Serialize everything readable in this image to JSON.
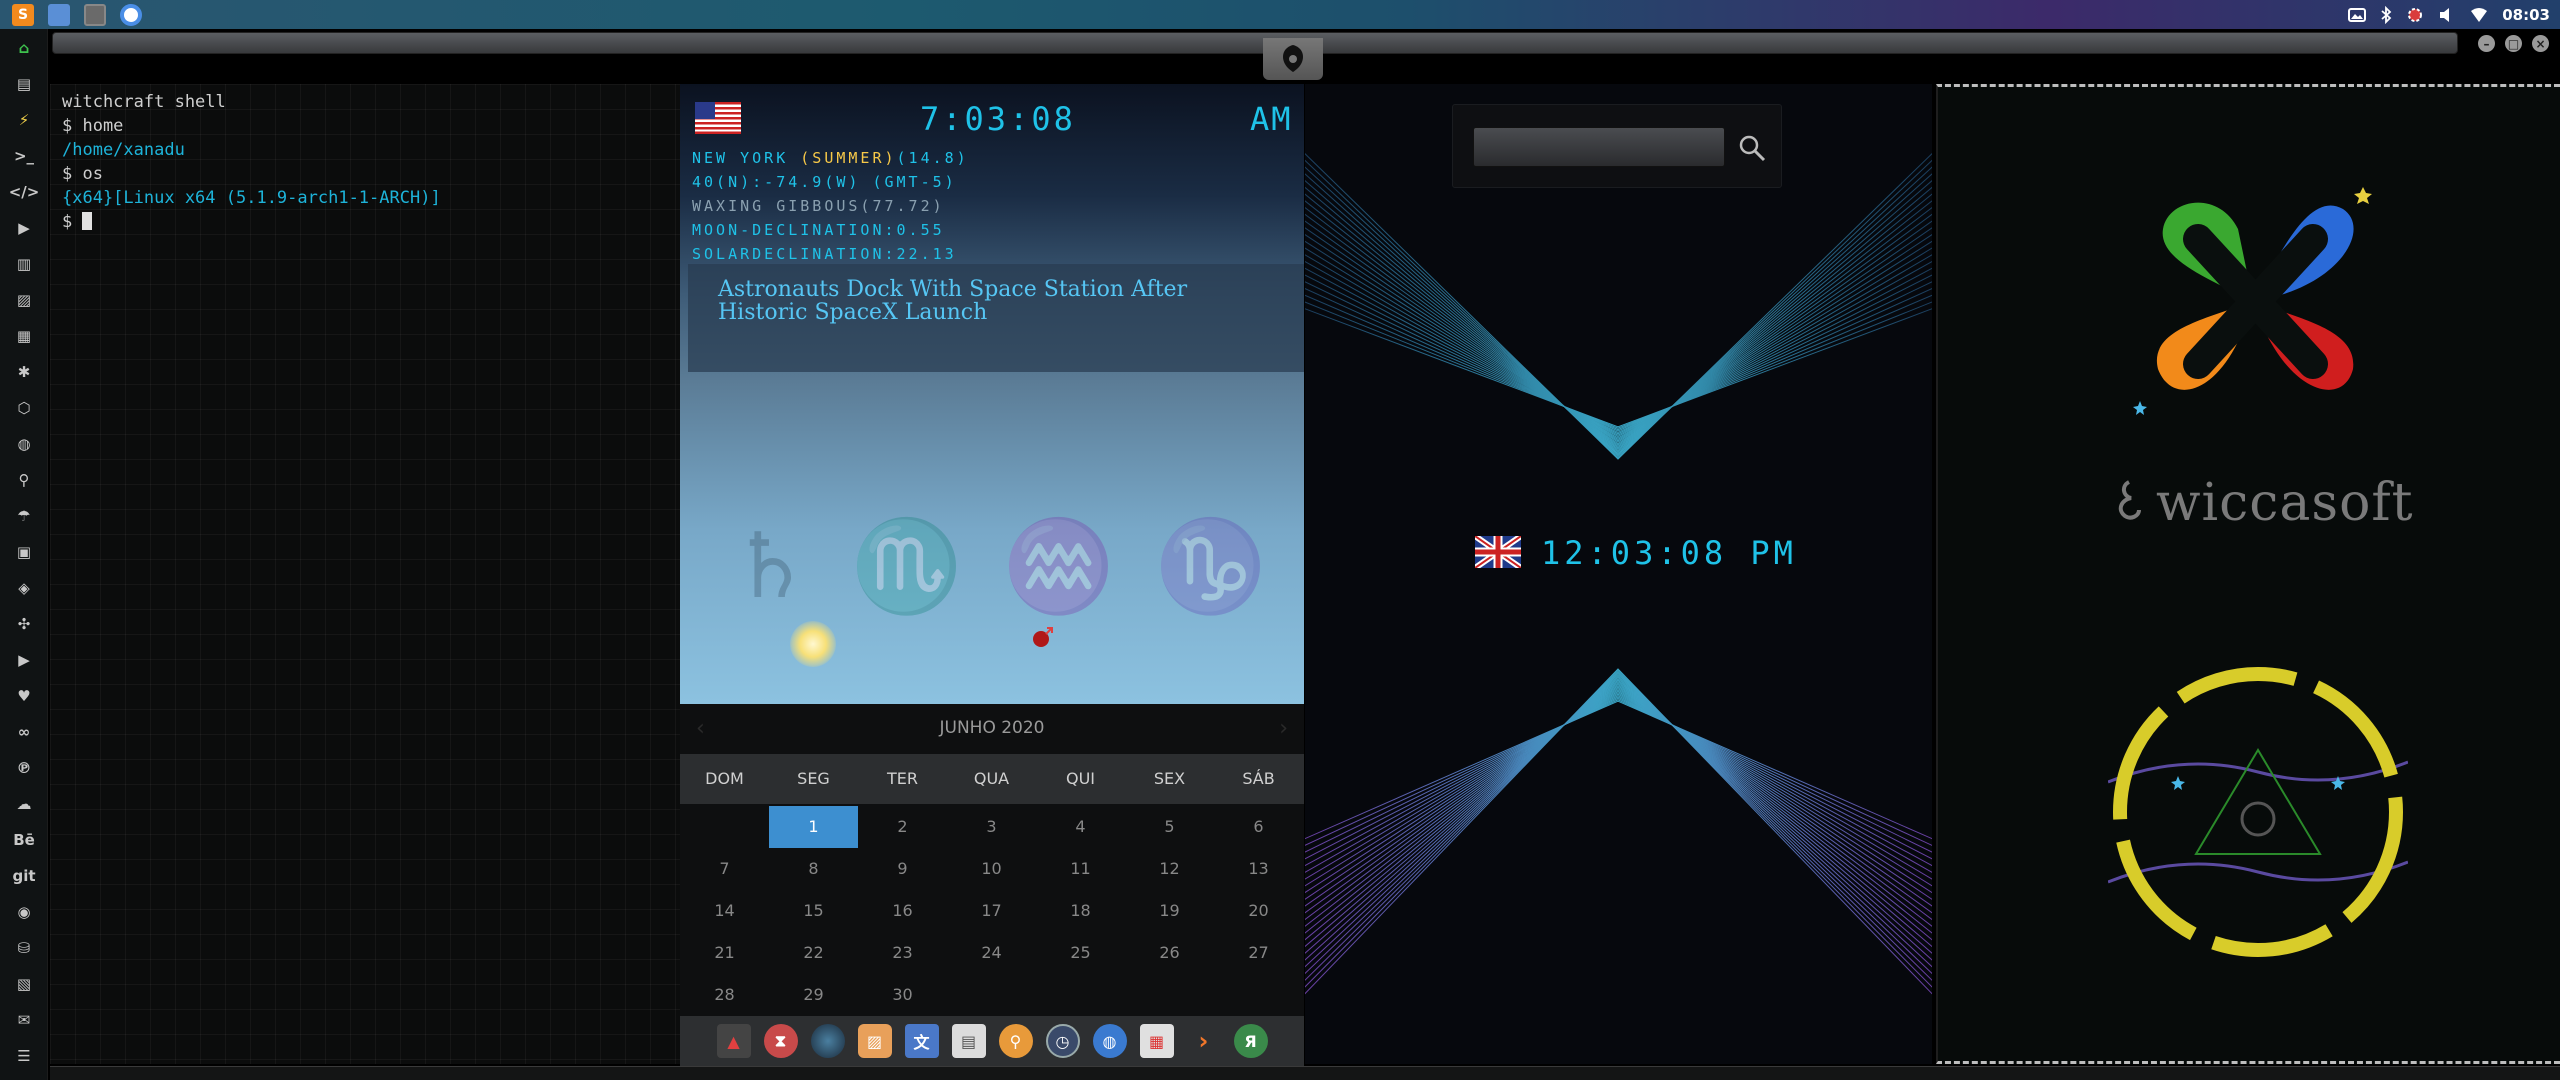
{
  "topbar": {
    "apps": [
      {
        "name": "sublime-text-icon",
        "color": "#f28a1e"
      },
      {
        "name": "files-icon",
        "color": "#5a8fd6"
      },
      {
        "name": "workspace-icon",
        "color": "#6a6a6a"
      },
      {
        "name": "chromium-icon",
        "color": "#4a8ee6"
      }
    ],
    "clock": "08:03"
  },
  "terminal": {
    "lines": [
      "witchcraft shell",
      "$ home",
      "/home/xanadu",
      "$ os",
      "{x64}[Linux x64 (5.1.9-arch1-1-ARCH)]",
      "$ "
    ]
  },
  "weather": {
    "time": "7:03:08",
    "ampm": "AM",
    "city_prefix": "NEW YORK ",
    "season": "(SUMMER)",
    "temp": "(14.8)",
    "coords": "40(N):-74.9(W) (GMT-5)",
    "moon_phase": "WAXING GIBBOUS(77.72)",
    "moon_declination": "MOON-DECLINATION:0.55",
    "solar_declination": "SOLARDECLINATION:22.13",
    "headline": "Astronauts Dock With Space Station After Historic SpaceX Launch"
  },
  "calendar": {
    "title": "JUNHO 2020",
    "weekdays": [
      "DOM",
      "SEG",
      "TER",
      "QUA",
      "QUI",
      "SEX",
      "SÁB"
    ],
    "rows": [
      [
        "",
        "1",
        "2",
        "3",
        "4",
        "5",
        "6"
      ],
      [
        "7",
        "8",
        "9",
        "10",
        "11",
        "12",
        "13"
      ],
      [
        "14",
        "15",
        "16",
        "17",
        "18",
        "19",
        "20"
      ],
      [
        "21",
        "22",
        "23",
        "24",
        "25",
        "26",
        "27"
      ],
      [
        "28",
        "29",
        "30",
        "",
        "",
        "",
        ""
      ]
    ],
    "selected": "1"
  },
  "space_panel": {
    "search_value": "",
    "uk_time": "12:03:08 PM"
  },
  "wiccasoft": {
    "brand": "wiccasoft"
  },
  "sidebar": {
    "items": [
      "home",
      "document",
      "bolt",
      "terminal",
      "code",
      "play",
      "files",
      "image",
      "news",
      "settings",
      "hexagon",
      "globe",
      "search",
      "umbrella",
      "contacts",
      "tag",
      "expand",
      "youtube",
      "heart",
      "infinity",
      "pinterest",
      "cloud",
      "Bē",
      "git",
      "github",
      "bitbucket",
      "map",
      "mail",
      "server"
    ]
  }
}
